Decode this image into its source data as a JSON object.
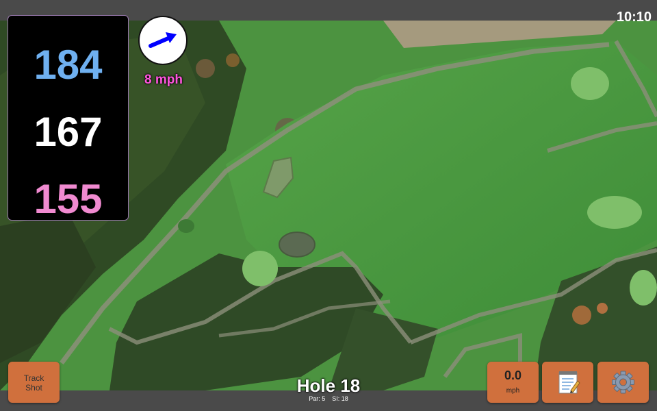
{
  "status_bar": {
    "time": "10:10"
  },
  "distances": {
    "back": "184",
    "middle": "167",
    "front": "155"
  },
  "wind": {
    "speed_label": "8 mph",
    "icon": "arrow-icon",
    "color": "#0000ff"
  },
  "buttons": {
    "track_shot": "Track\nShot",
    "speed_value": "0.0",
    "speed_unit": "mph",
    "notes_icon": "notepad-icon",
    "settings_icon": "gear-icon"
  },
  "hole": {
    "title": "Hole 18",
    "par": "Par: 5",
    "si": "SI: 18"
  },
  "colors": {
    "accent": "#d0703d",
    "back_distance": "#6fb0f0",
    "middle_distance": "#ffffff",
    "front_distance": "#f08ad0",
    "wind_label": "#ff55dd"
  }
}
